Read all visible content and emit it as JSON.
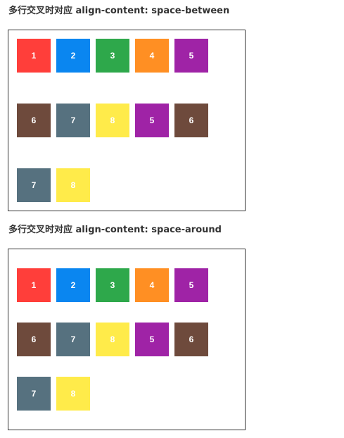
{
  "sections": [
    {
      "title": "多行交叉时对应 align-content: space-between",
      "items": [
        "1",
        "2",
        "3",
        "4",
        "5",
        "6",
        "7",
        "8",
        "5",
        "6",
        "7",
        "8"
      ]
    },
    {
      "title": "多行交叉时对应 align-content: space-around",
      "items": [
        "1",
        "2",
        "3",
        "4",
        "5",
        "6",
        "7",
        "8",
        "5",
        "6",
        "7",
        "8"
      ]
    }
  ],
  "colors": {
    "1": "#ff3e3a",
    "2": "#0a86f0",
    "3": "#2ea84b",
    "4": "#ff8f23",
    "5": "#9f23a6",
    "6": "#6e4a3c",
    "7": "#56717f",
    "8": "#ffeb4a"
  }
}
